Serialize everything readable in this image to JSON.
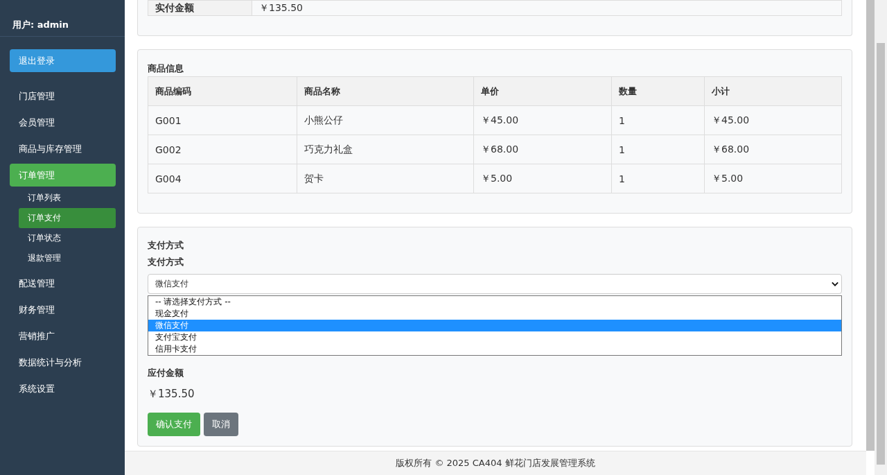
{
  "sidebar": {
    "user": "用户: admin",
    "logout_button": "退出登录",
    "nav": [
      {
        "label": "门店管理",
        "selected": false
      },
      {
        "label": "会员管理",
        "selected": false
      },
      {
        "label": "商品与库存管理",
        "selected": false
      },
      {
        "label": "订单管理",
        "selected": true,
        "children": [
          {
            "label": "订单列表",
            "selected": false
          },
          {
            "label": "订单支付",
            "selected": true
          },
          {
            "label": "订单状态",
            "selected": false
          },
          {
            "label": "退款管理",
            "selected": false
          }
        ]
      },
      {
        "label": "配送管理",
        "selected": false
      },
      {
        "label": "财务管理",
        "selected": false
      },
      {
        "label": "营销推广",
        "selected": false
      },
      {
        "label": "数据统计与分析",
        "selected": false
      },
      {
        "label": "系统设置",
        "selected": false
      }
    ]
  },
  "summary": {
    "rows": [
      {
        "label": "实付金额",
        "value": "￥135.50"
      }
    ]
  },
  "products": {
    "title": "商品信息",
    "columns": [
      "商品编码",
      "商品名称",
      "单价",
      "数量",
      "小计"
    ],
    "rows": [
      [
        "G001",
        "小熊公仔",
        "￥45.00",
        "1",
        "￥45.00"
      ],
      [
        "G002",
        "巧克力礼盒",
        "￥68.00",
        "1",
        "￥68.00"
      ],
      [
        "G004",
        "贺卡",
        "￥5.00",
        "1",
        "￥5.00"
      ]
    ]
  },
  "payment": {
    "title": "支付方式",
    "label": "支付方式",
    "select": {
      "value": "微信支付",
      "options": [
        {
          "label": "-- 请选择支付方式 --",
          "selected": false
        },
        {
          "label": "现金支付",
          "selected": false
        },
        {
          "label": "微信支付",
          "selected": true
        },
        {
          "label": "支付宝支付",
          "selected": false
        },
        {
          "label": "信用卡支付",
          "selected": false
        }
      ]
    },
    "amount_label": "应付金额",
    "amount": "￥135.50",
    "buttons": [
      {
        "label": "确认支付",
        "kind": "primary"
      },
      {
        "label": "取消",
        "kind": "secondary"
      }
    ]
  },
  "footer": "版权所有 © 2025 CA404 鲜花门店发展管理系统"
}
